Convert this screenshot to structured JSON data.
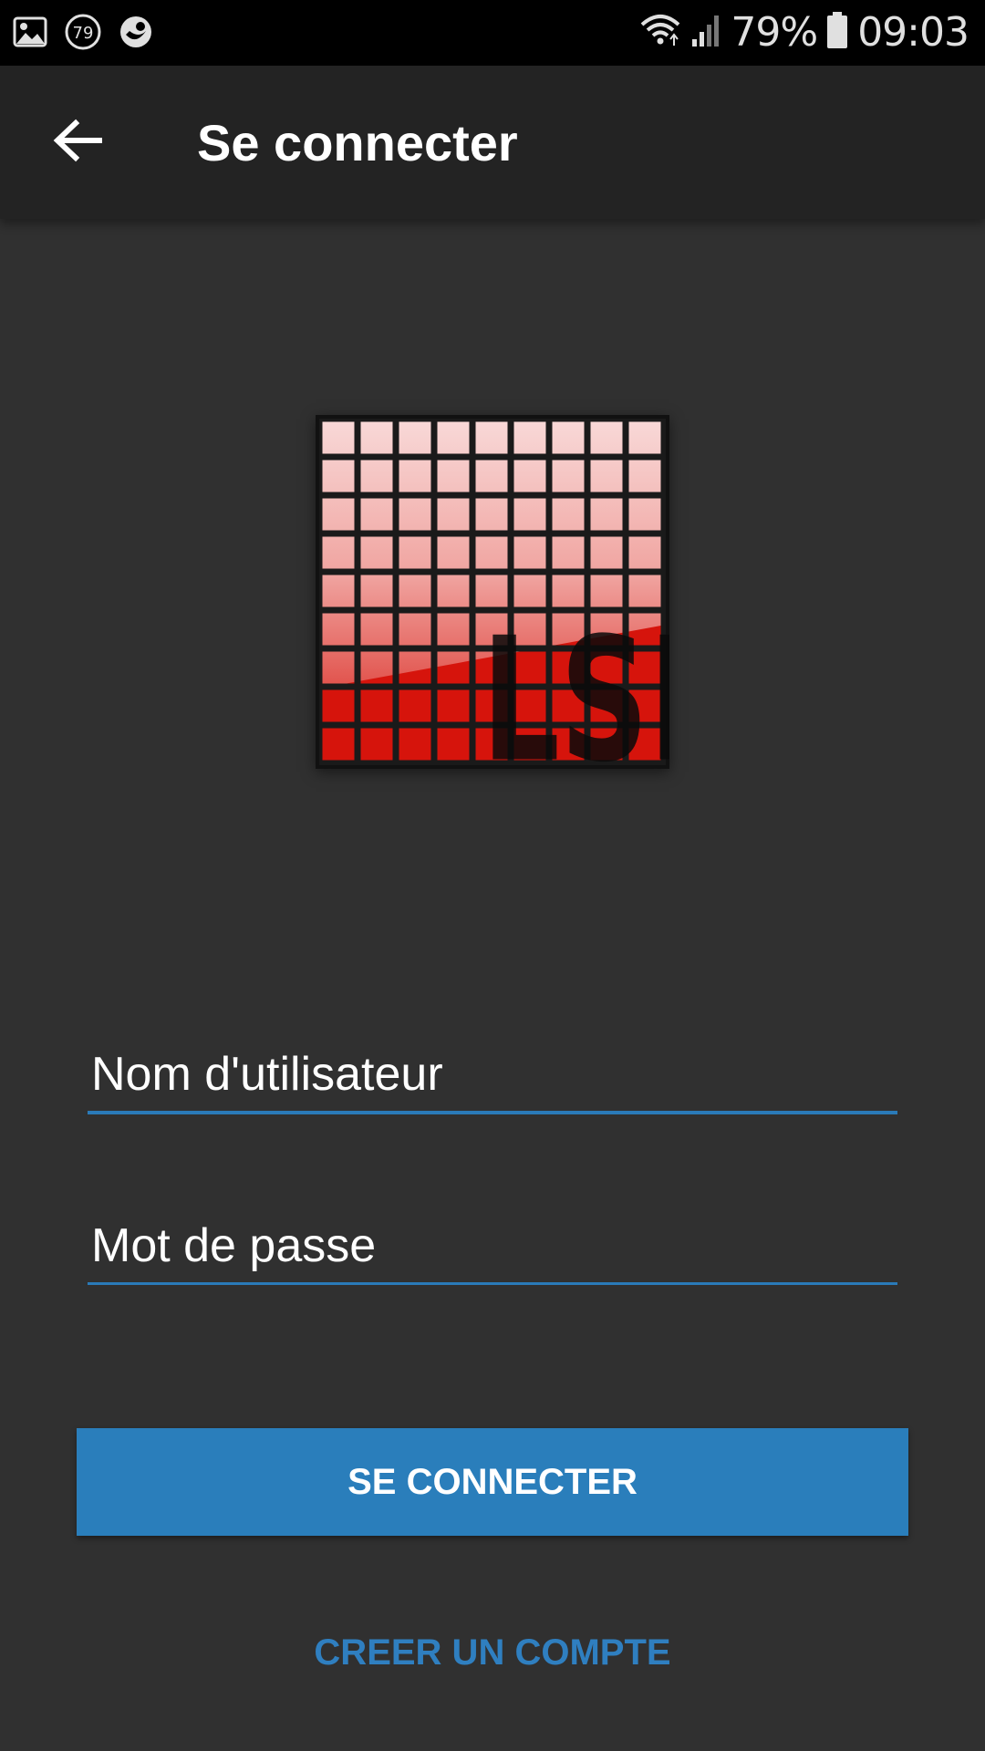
{
  "status_bar": {
    "left_icons": [
      "gallery-icon",
      "badge-79-icon",
      "app-notification-icon"
    ],
    "badge_number": "79",
    "battery_percent": "79%",
    "time": "09:03",
    "right_icons": [
      "wifi-icon",
      "signal-icon",
      "battery-icon"
    ]
  },
  "app_bar": {
    "title": "Se connecter",
    "back_icon": "arrow-back-icon"
  },
  "logo": {
    "text": "LSE",
    "accent": "#d81a12"
  },
  "form": {
    "username_placeholder": "Nom d'utilisateur",
    "password_placeholder": "Mot de passe",
    "submit_label": "SE CONNECTER",
    "create_account_label": "CREER UN COMPTE"
  },
  "colors": {
    "background": "#303030",
    "app_bar": "#232323",
    "accent": "#2a7ebb",
    "link": "#2f7fc0"
  }
}
